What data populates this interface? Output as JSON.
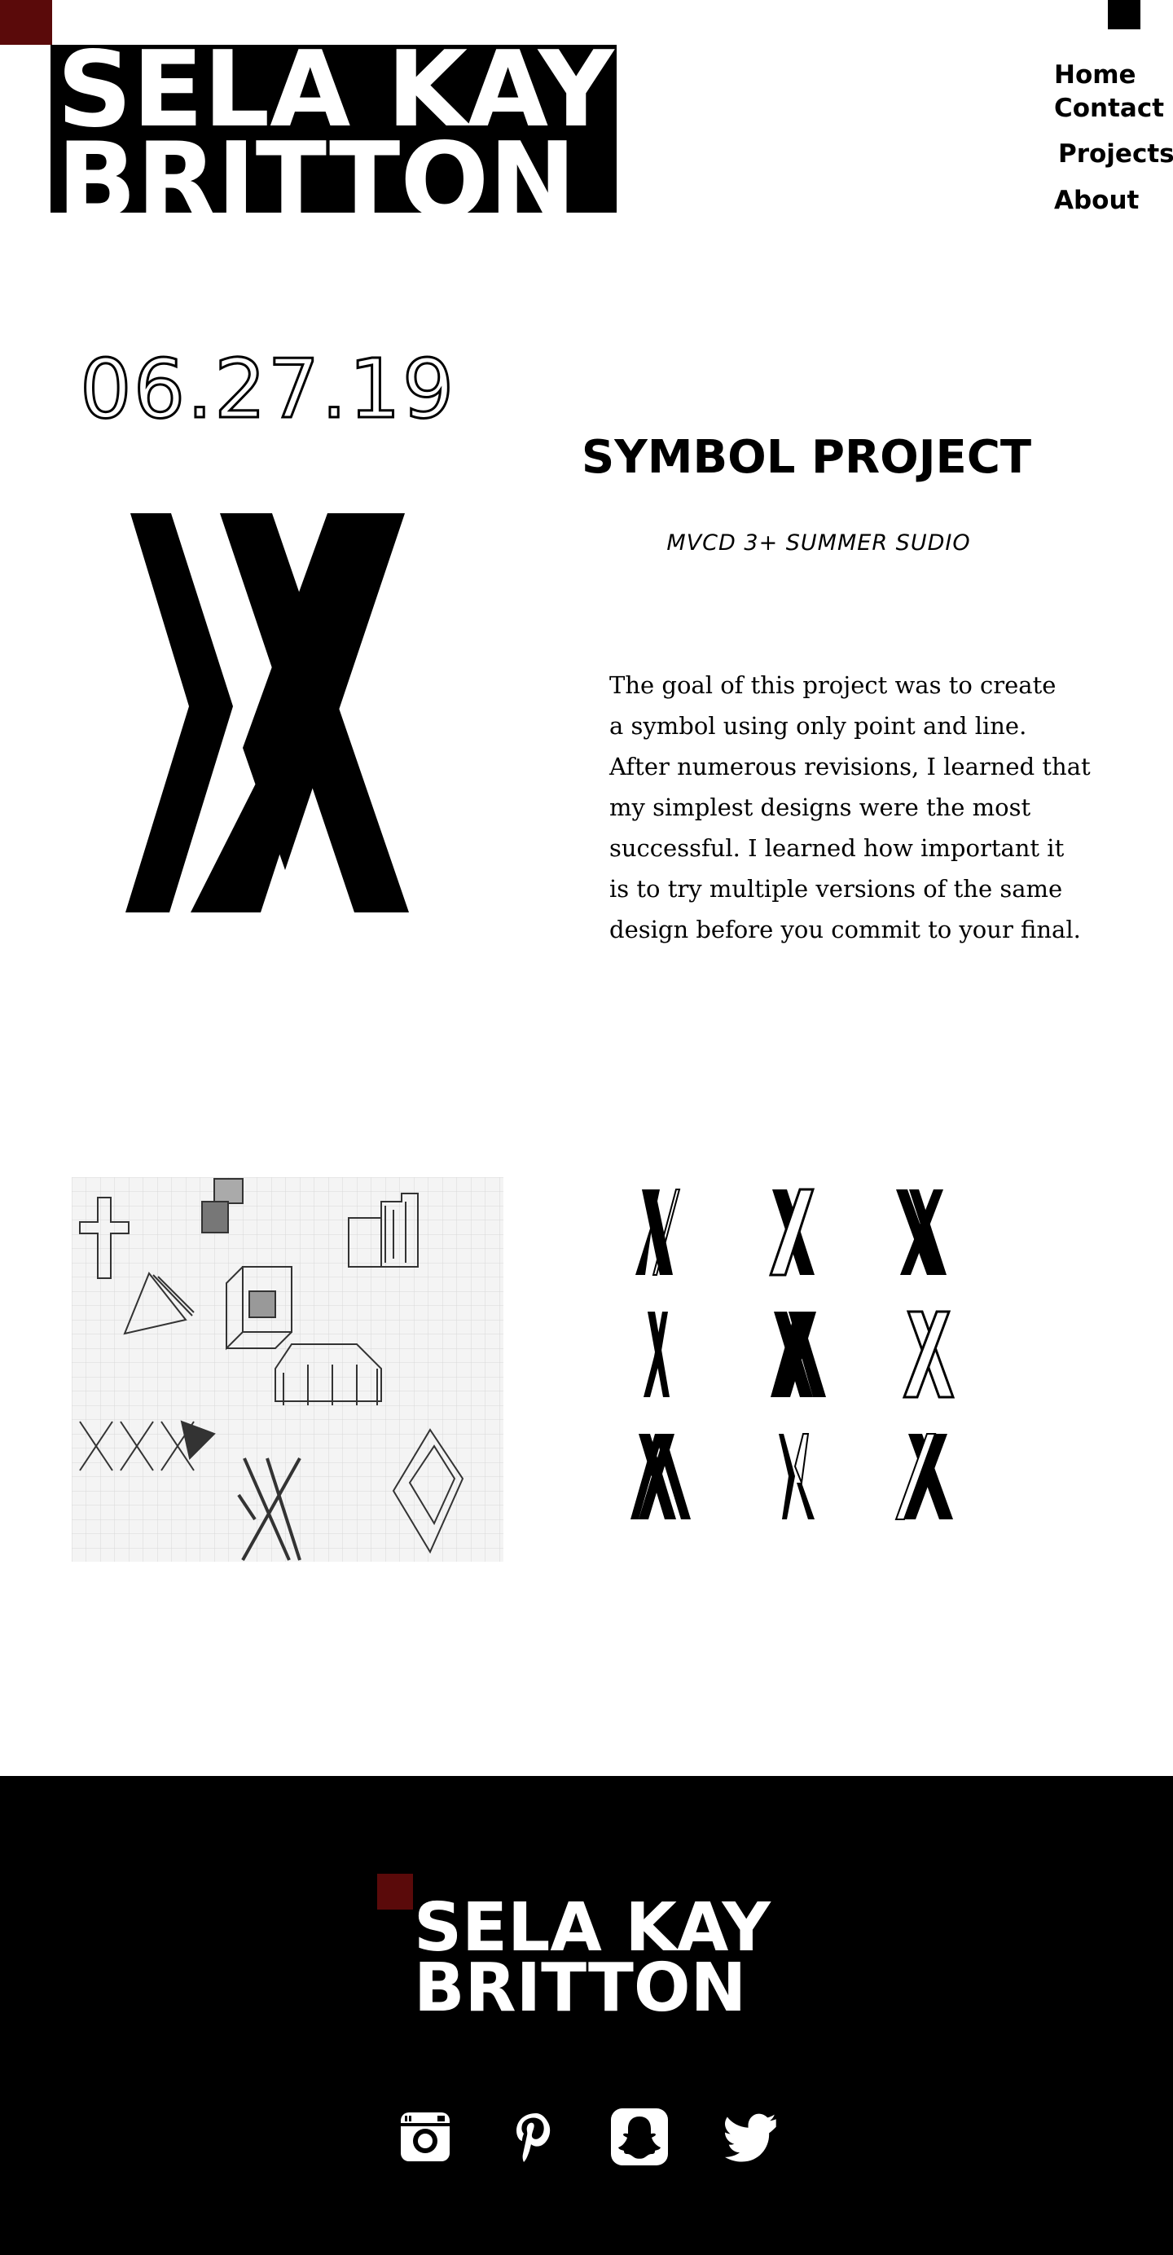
{
  "header": {
    "logo_line1": "SELA KAY",
    "logo_line2": "BRITTON",
    "nav": {
      "home": "Home",
      "contact": "Contact",
      "projects": "Projects",
      "about": "About"
    }
  },
  "project": {
    "date": "06.27.19",
    "title": "SYMBOL PROJECT",
    "subtitle": "MVCD 3+ SUMMER SUDIO",
    "description_lines": [
      "The goal of this project was to create",
      "a symbol using only point and line.",
      "After numerous revisions, I learned that",
      "my simplest designs were the most",
      "successful. I learned how important it",
      "is to try multiple versions of the same",
      "design before you commit to your final."
    ]
  },
  "footer": {
    "logo_line1": "SELA KAY",
    "logo_line2": "BRITTON",
    "social_icons": [
      "instagram-icon",
      "pinterest-icon",
      "snapchat-icon",
      "twitter-icon"
    ]
  },
  "colors": {
    "accent": "#5a0a0a",
    "black": "#000000",
    "white": "#ffffff"
  }
}
